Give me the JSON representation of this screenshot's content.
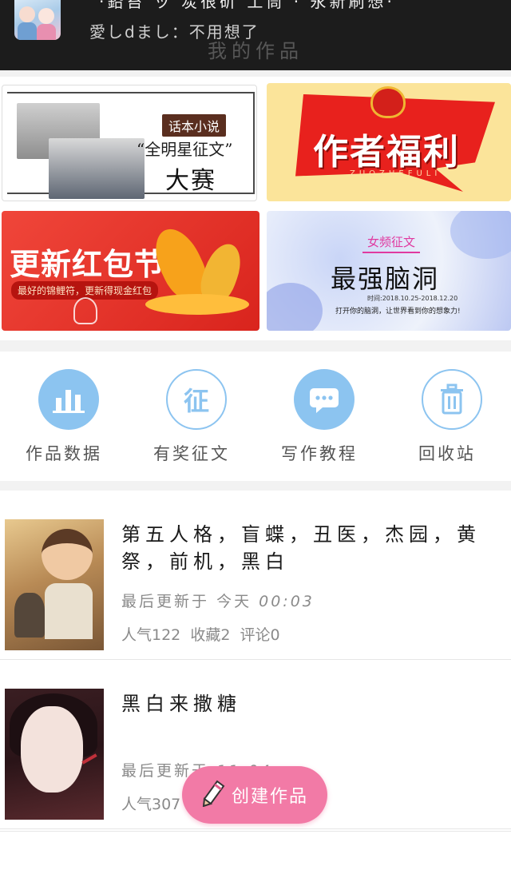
{
  "topbar": {
    "scroll_text": "·鉛笞 ッ 炭很斫 工筒 · 永新刷想·",
    "sub_text": "愛しdまし：不用想了",
    "page_title": "我的作品"
  },
  "banners": {
    "contest": {
      "tag": "话本小说",
      "line2": "“全明星征文”",
      "line3": "大赛"
    },
    "welfare": {
      "title": "作者福利",
      "pinyin": "ZUOZHEFULI"
    },
    "red_packet": {
      "title": "更新红包节",
      "slogan": "最好的锦鲤符，更新得现金红包"
    },
    "brain": {
      "tag": "女频征文",
      "title": "最强脑洞",
      "date": "时间:2018.10.25-2018.12.20",
      "slogan": "打开你的脑洞，让世界看到你的想象力!"
    }
  },
  "tools": [
    {
      "label": "作品数据",
      "icon": "bar-chart-icon"
    },
    {
      "label": "有奖征文",
      "icon": "contest-icon",
      "glyph": "征"
    },
    {
      "label": "写作教程",
      "icon": "chat-bubble-icon"
    },
    {
      "label": "回收站",
      "icon": "trash-icon"
    }
  ],
  "works": [
    {
      "title": "第五人格，盲蝶，丑医，杰园，黄祭，前机，黑白",
      "updated_prefix": "最后更新于",
      "updated_day": "今天",
      "updated_time": "00:03",
      "popularity": "人气122",
      "favorites": "收藏2",
      "comments": "评论0"
    },
    {
      "title": "黑白来撒糖",
      "updated_prefix": "最后更新于",
      "updated_day": "",
      "updated_time": "11:04",
      "popularity": "人气307",
      "favorites": "",
      "comments": ""
    }
  ],
  "create_button": {
    "label": "创建作品",
    "icon": "pencil-icon"
  },
  "colors": {
    "accent_blue": "#8cc4f0",
    "create_pink": "#f27aa6",
    "topbar": "#1c1c1c"
  }
}
